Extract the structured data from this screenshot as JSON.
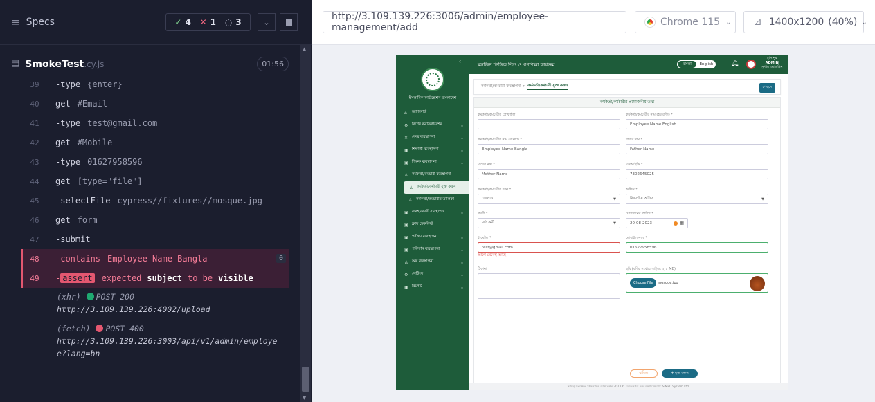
{
  "runner": {
    "specs_label": "Specs",
    "passed": "4",
    "failed": "1",
    "pending": "3",
    "file_name": "SmokeTest",
    "file_ext": ".cy.js",
    "duration": "01:56",
    "commands": [
      {
        "n": "39",
        "name": "-type",
        "arg": "{enter}",
        "err": false
      },
      {
        "n": "40",
        "name": "get",
        "arg": "#Email",
        "err": false
      },
      {
        "n": "41",
        "name": "-type",
        "arg": "test@gmail.com",
        "err": false
      },
      {
        "n": "42",
        "name": "get",
        "arg": "#Mobile",
        "err": false
      },
      {
        "n": "43",
        "name": "-type",
        "arg": "01627958596",
        "err": false
      },
      {
        "n": "44",
        "name": "get",
        "arg": "[type=\"file\"]",
        "err": false
      },
      {
        "n": "45",
        "name": "-selectFile",
        "arg": "cypress//fixtures//mosque.jpg",
        "err": false
      },
      {
        "n": "46",
        "name": "get",
        "arg": "form",
        "err": false
      },
      {
        "n": "47",
        "name": "-submit",
        "arg": "",
        "err": false
      },
      {
        "n": "48",
        "name": "-contains",
        "arg": "Employee Name Bangla",
        "err": true
      }
    ],
    "assert_line": {
      "n": "49",
      "dash": "-",
      "badge": "assert",
      "w1": "expected",
      "w2": "subject",
      "w3": "to be",
      "w4": "visible"
    },
    "contains_count": "0",
    "net1_type": "(xhr)",
    "net1_status": "POST 200",
    "net1_url": "http://3.109.139.226:4002/upload",
    "net2_type": "(fetch)",
    "net2_status": "POST 400",
    "net2_url1": "http://3.109.139.226:3003/api/v1/admin/employe",
    "net2_url2": "e?lang=bn"
  },
  "browserbar": {
    "url": "http://3.109.139.226:3006/admin/employee-management/add",
    "browser": "Chrome 115",
    "viewport": "1400x1200",
    "zoom": "(40%)"
  },
  "aut": {
    "header_title": "মসজিদ ভিত্তিক শিশু ও গণশিক্ষা কার্যক্রম",
    "lang_bn": "বাংলা",
    "lang_en": "English",
    "admin_line1": "হাসানুর",
    "admin_line2": "ADMIN",
    "admin_line3": "সুপার অ্যাডমিন",
    "org_name": "ইসলামিক ফাউন্ডেশন বাংলাদেশ",
    "menu": [
      {
        "icon": "⌂",
        "label": "ড্যাশবোর্ড",
        "caret": "",
        "cls": ""
      },
      {
        "icon": "⚙",
        "label": "বিশেষ কনফিগারেশন",
        "caret": "⌄",
        "cls": ""
      },
      {
        "icon": "✕",
        "label": "কেন্দ্র ব্যবস্থাপনা",
        "caret": "⌄",
        "cls": ""
      },
      {
        "icon": "▣",
        "label": "শিক্ষার্থী ব্যবস্থাপনা",
        "caret": "⌄",
        "cls": ""
      },
      {
        "icon": "▣",
        "label": "শিক্ষক ব্যবস্থাপনা",
        "caret": "⌄",
        "cls": ""
      },
      {
        "icon": "♙",
        "label": "কর্মকর্তা/কর্মচারী ব্যবস্থাপনা",
        "caret": "⌃",
        "cls": ""
      },
      {
        "icon": "♙",
        "label": "কর্মকর্তা/কর্মচারী যুক্ত করুন",
        "caret": "",
        "cls": "active sub"
      },
      {
        "icon": "♙",
        "label": "কর্মকর্তা/কর্মচারীর তালিকা",
        "caret": "",
        "cls": "sub"
      },
      {
        "icon": "▣",
        "label": "ব্যবহারকারী ব্যবস্থাপনা",
        "caret": "⌄",
        "cls": ""
      },
      {
        "icon": "▣",
        "label": "ক্লাস চেকলিস্ট",
        "caret": "",
        "cls": ""
      },
      {
        "icon": "▣",
        "label": "পরীক্ষা ব্যবস্থাপনা",
        "caret": "⌄",
        "cls": ""
      },
      {
        "icon": "▣",
        "label": "পরিদর্শন ব্যবস্থাপনা",
        "caret": "⌄",
        "cls": ""
      },
      {
        "icon": "♙",
        "label": "অর্থ ব্যবস্থাপনা",
        "caret": "⌄",
        "cls": ""
      },
      {
        "icon": "⚙",
        "label": "সেটিংস",
        "caret": "⌄",
        "cls": ""
      },
      {
        "icon": "▣",
        "label": "রিপোর্ট",
        "caret": "⌄",
        "cls": ""
      }
    ],
    "breadcrumb_parent": "কর্মকর্তা/কর্মচারী ব্যবস্থাপনা >",
    "breadcrumb_current": "কর্মকর্তা/কর্মচারী যুক্ত করুন",
    "back_button": "পেছনে",
    "form_title": "কর্মকর্তা/কর্মচারীর প্রয়োজনীয় তথ্য",
    "fields": {
      "photo_label": "কর্মকর্তা/কর্মচারীর প্রোফাইল",
      "photo_value": "",
      "name_en_label": "কর্মকর্তা/কর্মচারীর নাম (ইংরেজি) *",
      "name_en_value": "Employee Name English",
      "name_bn_label": "কর্মকর্তা/কর্মচারীর নাম (বাংলা) *",
      "name_bn_value": "Employee Name Bangla",
      "father_label": "বাবার নাম *",
      "father_value": "Father Name",
      "mother_label": "মায়ের নাম *",
      "mother_value": "Mother Name",
      "nid_label": "এনআইডি *",
      "nid_value": "7302645025",
      "role_label": "কর্মকর্তা/কর্মচারীর ধরন *",
      "role_value": "জেলান",
      "office_label": "অফিস *",
      "office_value": "বিভাগীয় অফিস",
      "post_label": "পদবী *",
      "post_value": "মাঠ কর্মী",
      "join_label": "যোগদানের তারিখ *",
      "join_value": "20-08-2023",
      "email_label": "ই-মেইল *",
      "email_value": "test@gmail.com",
      "email_error": "আগে থেকেই আছে",
      "mobile_label": "মোবাইল নম্বর *",
      "mobile_value": "01627958596",
      "address_label": "ঠিকানা",
      "image_label": "ছবি (ছবির সর্বোচ্চ সাইজ: ২.৫ MB)",
      "choose_file": "Choose File",
      "file_name": "mosque.jpg"
    },
    "cancel_button": "বাতিল",
    "submit_button": "+ যুক্ত করুন",
    "footer": "সর্বস্বত্ব সংরক্ষিত : ইসলামিক ফাউন্ডেশন 2023 © ডেভেলপড এন্ড রক্ষণাবেক্ষণে : SIMEC System Ltd."
  }
}
